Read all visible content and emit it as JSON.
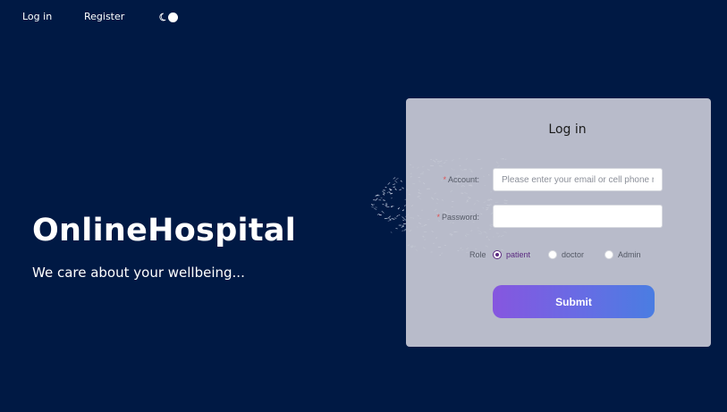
{
  "nav": {
    "login_label": "Log in",
    "register_label": "Register"
  },
  "theme_toggle": {
    "icon": "moon-icon"
  },
  "hero": {
    "title": "OnlineHospital",
    "subtitle": "We care about your wellbeing..."
  },
  "login_form": {
    "title": "Log in",
    "account": {
      "label": "Account",
      "placeholder": "Please enter your email or cell phone number",
      "value": ""
    },
    "password": {
      "label": "Password",
      "value": ""
    },
    "role": {
      "label": "Role",
      "options": [
        "patient",
        "doctor",
        "Admin"
      ],
      "selected": "patient"
    },
    "submit_label": "Submit"
  },
  "colors": {
    "background": "#001944",
    "accent": "#5a2a80",
    "button_start": "#8656df",
    "button_end": "#4a7de2"
  }
}
